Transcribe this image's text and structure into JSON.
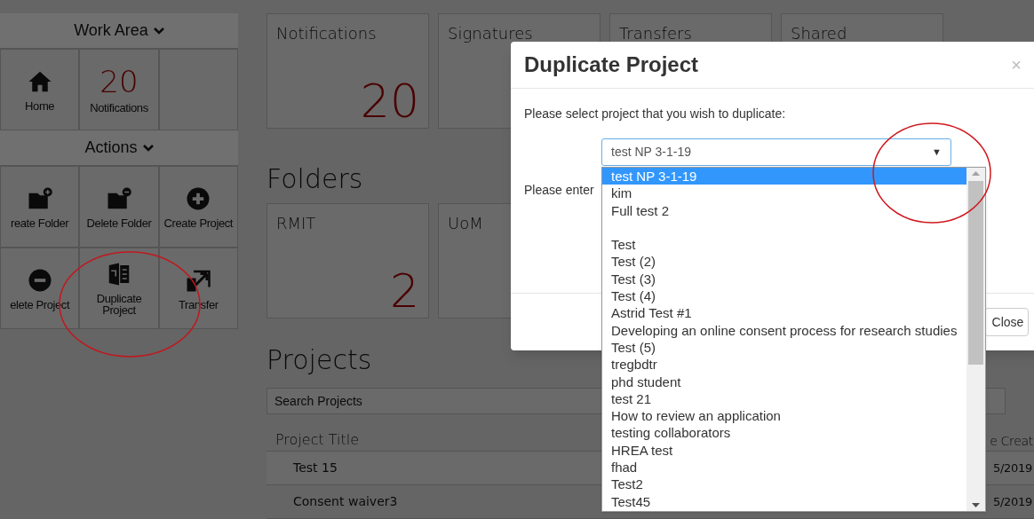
{
  "sidebar": {
    "sections": [
      {
        "title": "Work Area",
        "tiles": [
          {
            "kind": "home",
            "label": "Home"
          },
          {
            "kind": "count",
            "count": "20",
            "label": "Notifications"
          },
          {
            "kind": "empty"
          }
        ]
      },
      {
        "title": "Actions",
        "tiles": [
          {
            "kind": "folder-add",
            "label": "reate Folder"
          },
          {
            "kind": "folder-remove",
            "label": "Delete Folder"
          },
          {
            "kind": "add",
            "label": "Create Project"
          },
          {
            "kind": "remove",
            "label": "elete Project"
          },
          {
            "kind": "duplicate",
            "label": "Duplicate Project"
          },
          {
            "kind": "transfer",
            "label": "Transfer"
          }
        ]
      }
    ]
  },
  "summary_cards": [
    {
      "title": "Notifications",
      "count": "20"
    },
    {
      "title": "Signatures"
    },
    {
      "title": "Transfers"
    },
    {
      "title": "Shared"
    }
  ],
  "folders": {
    "heading": "Folders",
    "cards": [
      {
        "title": "RMIT",
        "count": "2"
      },
      {
        "title": "UoM"
      }
    ]
  },
  "projects": {
    "heading": "Projects",
    "search": {
      "placeholder": "Search Projects"
    },
    "columns": [
      "Project Title",
      "e Creat"
    ],
    "rows": [
      [
        "Test 15",
        "5/2019"
      ],
      [
        "Consent waiver3",
        "5/2019"
      ]
    ]
  },
  "modal": {
    "title": "Duplicate Project",
    "close": "×",
    "prompt": "Please select project that you wish to duplicate:",
    "second_prompt": "Please enter",
    "select_value": "test NP 3-1-19",
    "select_arrow": "▼",
    "footer_button": "Close",
    "options": [
      {
        "label": "test NP 3-1-19",
        "selected": true
      },
      {
        "label": "kim",
        "selected": false
      },
      {
        "label": "Full test 2",
        "selected": false
      },
      {
        "label": "Test",
        "selected": false,
        "gap_before": true
      },
      {
        "label": "Test (2)",
        "selected": false
      },
      {
        "label": "Test (3)",
        "selected": false
      },
      {
        "label": "Test (4)",
        "selected": false
      },
      {
        "label": "Astrid Test #1",
        "selected": false
      },
      {
        "label": "Developing an online consent process for research studies",
        "selected": false
      },
      {
        "label": "Test (5)",
        "selected": false
      },
      {
        "label": "tregbdtr",
        "selected": false
      },
      {
        "label": "phd student",
        "selected": false
      },
      {
        "label": "test 21",
        "selected": false
      },
      {
        "label": "How to review an application",
        "selected": false
      },
      {
        "label": "testing collaborators",
        "selected": false
      },
      {
        "label": "HREA test",
        "selected": false
      },
      {
        "label": "fhad",
        "selected": false
      },
      {
        "label": "Test2",
        "selected": false
      },
      {
        "label": "Test45",
        "selected": false
      }
    ]
  }
}
